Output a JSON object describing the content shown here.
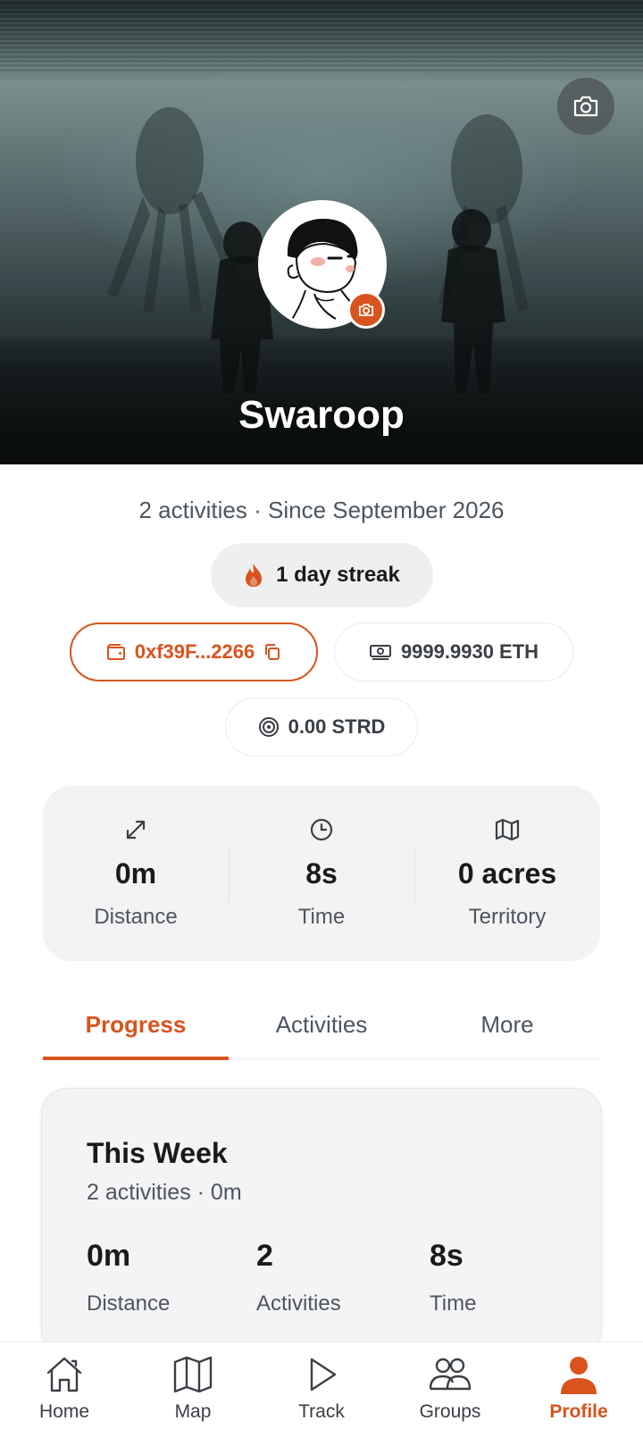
{
  "profile": {
    "name": "Swaroop",
    "meta": "2 activities · Since September 2026",
    "streak": "1 day streak"
  },
  "wallet": {
    "address": "0xf39F...2266",
    "eth_balance": "9999.9930 ETH",
    "strd_balance": "0.00 STRD"
  },
  "stats": [
    {
      "icon": "expand-arrows-icon",
      "value": "0m",
      "label": "Distance"
    },
    {
      "icon": "clock-icon",
      "value": "8s",
      "label": "Time"
    },
    {
      "icon": "map-icon",
      "value": "0 acres",
      "label": "Territory"
    }
  ],
  "tabs": [
    "Progress",
    "Activities",
    "More"
  ],
  "this_week": {
    "title": "This Week",
    "subtitle": "2 activities · 0m",
    "metrics": [
      {
        "value": "0m",
        "label": "Distance"
      },
      {
        "value": "2",
        "label": "Activities"
      },
      {
        "value": "8s",
        "label": "Time"
      }
    ]
  },
  "nav": [
    {
      "label": "Home",
      "icon": "home-icon"
    },
    {
      "label": "Map",
      "icon": "map-icon"
    },
    {
      "label": "Track",
      "icon": "play-icon"
    },
    {
      "label": "Groups",
      "icon": "groups-icon"
    },
    {
      "label": "Profile",
      "icon": "person-icon"
    }
  ],
  "colors": {
    "accent": "#d9531e",
    "muted_text": "#4d5561",
    "card_bg": "#f3f3f3"
  }
}
